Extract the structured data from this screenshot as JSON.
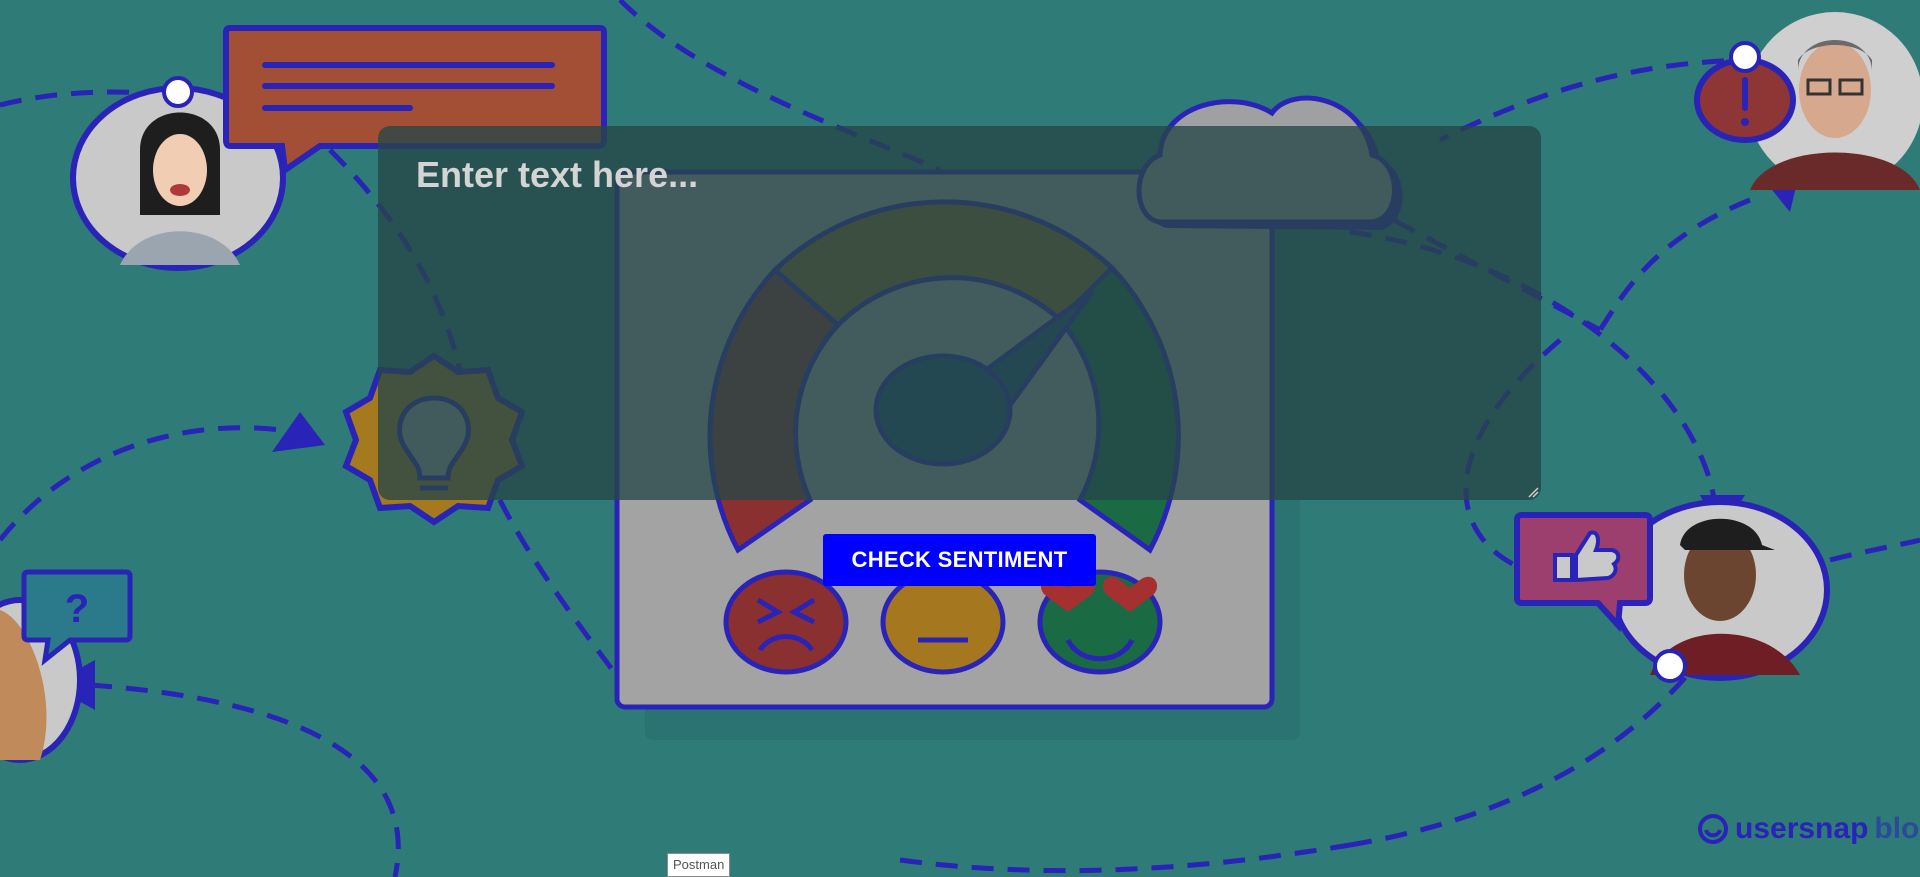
{
  "colors": {
    "background": "#2f7b78",
    "accent_blue": "#0000ff",
    "outline_blue": "#2a23b7"
  },
  "form": {
    "text_placeholder": "Enter text here...",
    "text_value": "",
    "check_button_label": "CHECK SENTIMENT"
  },
  "tooltip": {
    "text": "Postman"
  },
  "brand": {
    "name": "usersnap",
    "suffix": "blo"
  },
  "illustration": {
    "icons": [
      "speech-bubble-icon",
      "lightbulb-icon",
      "question-mark-icon",
      "exclamation-icon",
      "thumbs-up-icon",
      "cloud-icon",
      "gauge-icon",
      "angry-face-icon",
      "neutral-face-icon",
      "love-face-icon"
    ]
  }
}
